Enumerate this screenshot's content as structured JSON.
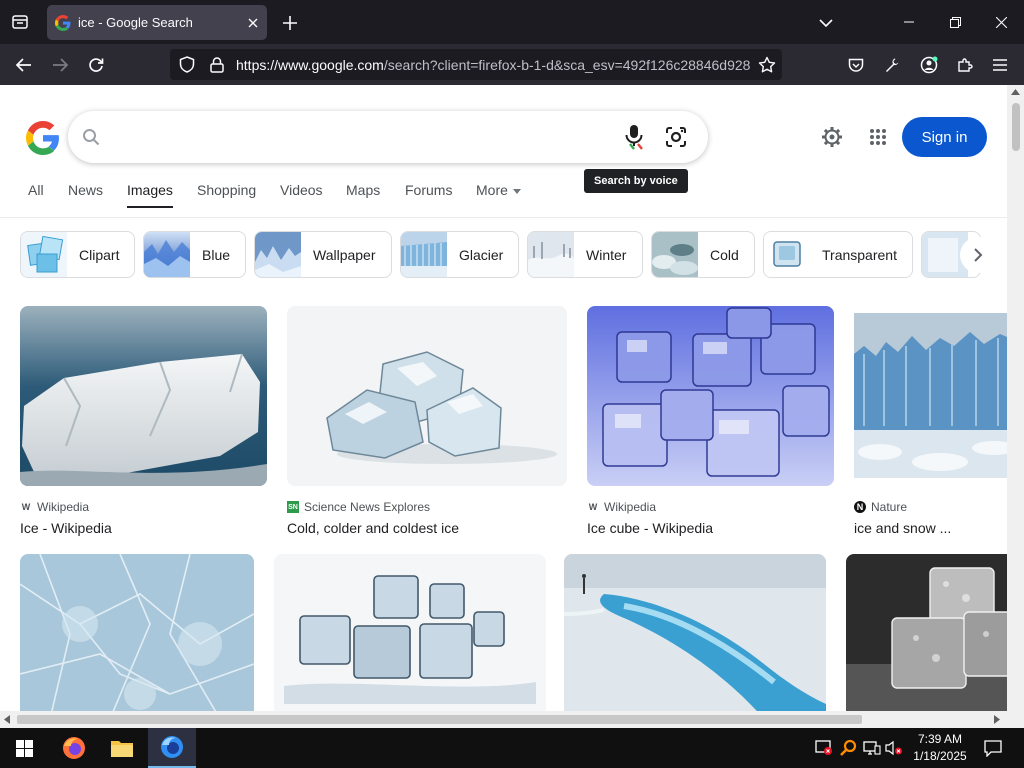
{
  "browser": {
    "tab_title": "ice - Google Search",
    "url_host": "https://www.google.com",
    "url_path": "/search?client=firefox-b-1-d&sca_esv=492f126c28846d928"
  },
  "google": {
    "search_value": "",
    "tooltip": "Search by voice",
    "signin_label": "Sign in",
    "tabs": [
      "All",
      "News",
      "Images",
      "Shopping",
      "Videos",
      "Maps",
      "Forums",
      "More"
    ],
    "active_tab": "Images",
    "chips": [
      "Clipart",
      "Blue",
      "Wallpaper",
      "Glacier",
      "Winter",
      "Cold",
      "Transparent"
    ],
    "results": [
      {
        "source": "Wikipedia",
        "title": "Ice - Wikipedia",
        "source_icon": "W"
      },
      {
        "source": "Science News Explores",
        "title": "Cold, colder and coldest ice",
        "source_icon": "SN"
      },
      {
        "source": "Wikipedia",
        "title": "Ice cube - Wikipedia",
        "source_icon": "W"
      },
      {
        "source": "Nature",
        "title": "ice and snow ...",
        "source_icon": "N"
      }
    ]
  },
  "taskbar": {
    "time": "7:39 AM",
    "date": "1/18/2025"
  },
  "colors": {
    "accent": "#0b57d0",
    "tab_bg": "#42414d",
    "toolbar_bg": "#2b2a33",
    "titlebar_bg": "#1c1b22"
  }
}
